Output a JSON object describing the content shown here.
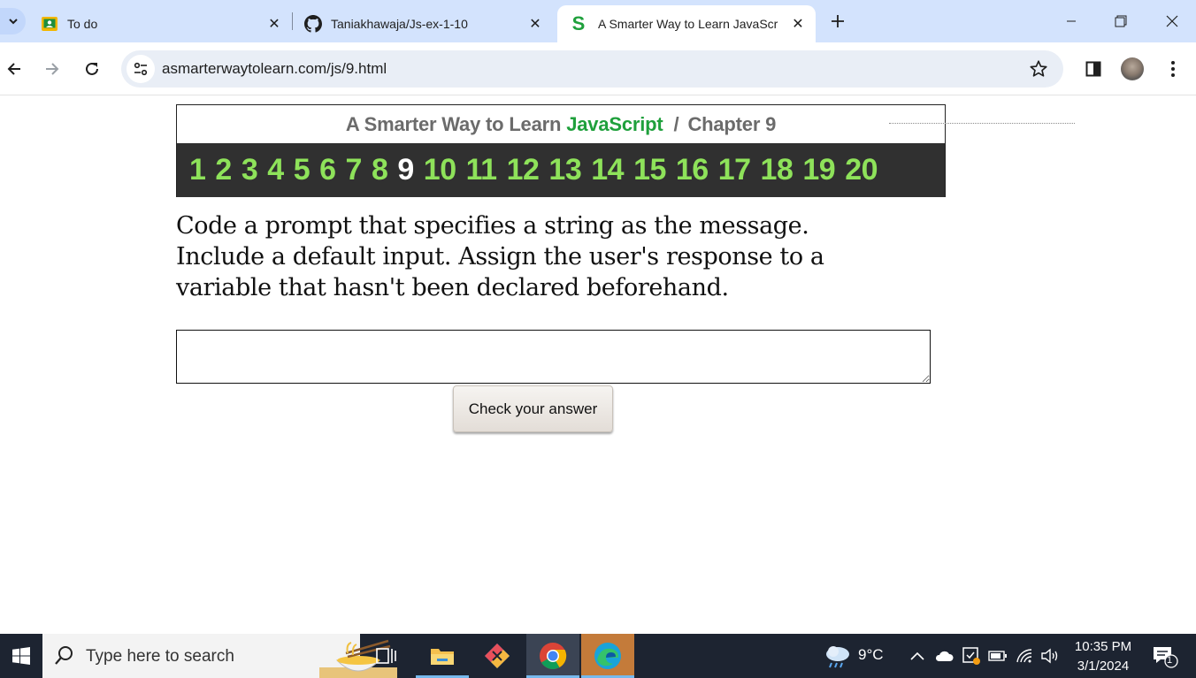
{
  "browser": {
    "tabs": [
      {
        "title": "To do",
        "icon": "google-classroom-icon",
        "active": false
      },
      {
        "title": "Taniakhawaja/Js-ex-1-10",
        "icon": "github-icon",
        "active": false
      },
      {
        "title": "A Smarter Way to Learn JavaScr",
        "icon": "smarter-way-s-icon",
        "active": true
      }
    ],
    "url": "asmarterwaytolearn.com/js/9.html"
  },
  "page": {
    "header": {
      "prefix": "A Smarter Way to Learn",
      "brand": "JavaScript",
      "separator": "/",
      "chapter": "Chapter 9"
    },
    "chapters": [
      "1",
      "2",
      "3",
      "4",
      "5",
      "6",
      "7",
      "8",
      "9",
      "10",
      "11",
      "12",
      "13",
      "14",
      "15",
      "16",
      "17",
      "18",
      "19",
      "20"
    ],
    "current_chapter": "9",
    "question": "Code a prompt that specifies a string as the message. Include a default input. Assign the user's response to a variable that hasn't been declared beforehand.",
    "answer_value": "",
    "check_button": "Check your answer"
  },
  "taskbar": {
    "search_placeholder": "Type here to search",
    "weather": "9°C",
    "time": "10:35 PM",
    "date": "3/1/2024",
    "notifications": "1"
  },
  "colors": {
    "tabstrip": "#d3e3fd",
    "brand_green": "#1fa03c",
    "chapter_green": "#8ee25a",
    "chapter_bar": "#303030",
    "taskbar": "#1d2431"
  }
}
